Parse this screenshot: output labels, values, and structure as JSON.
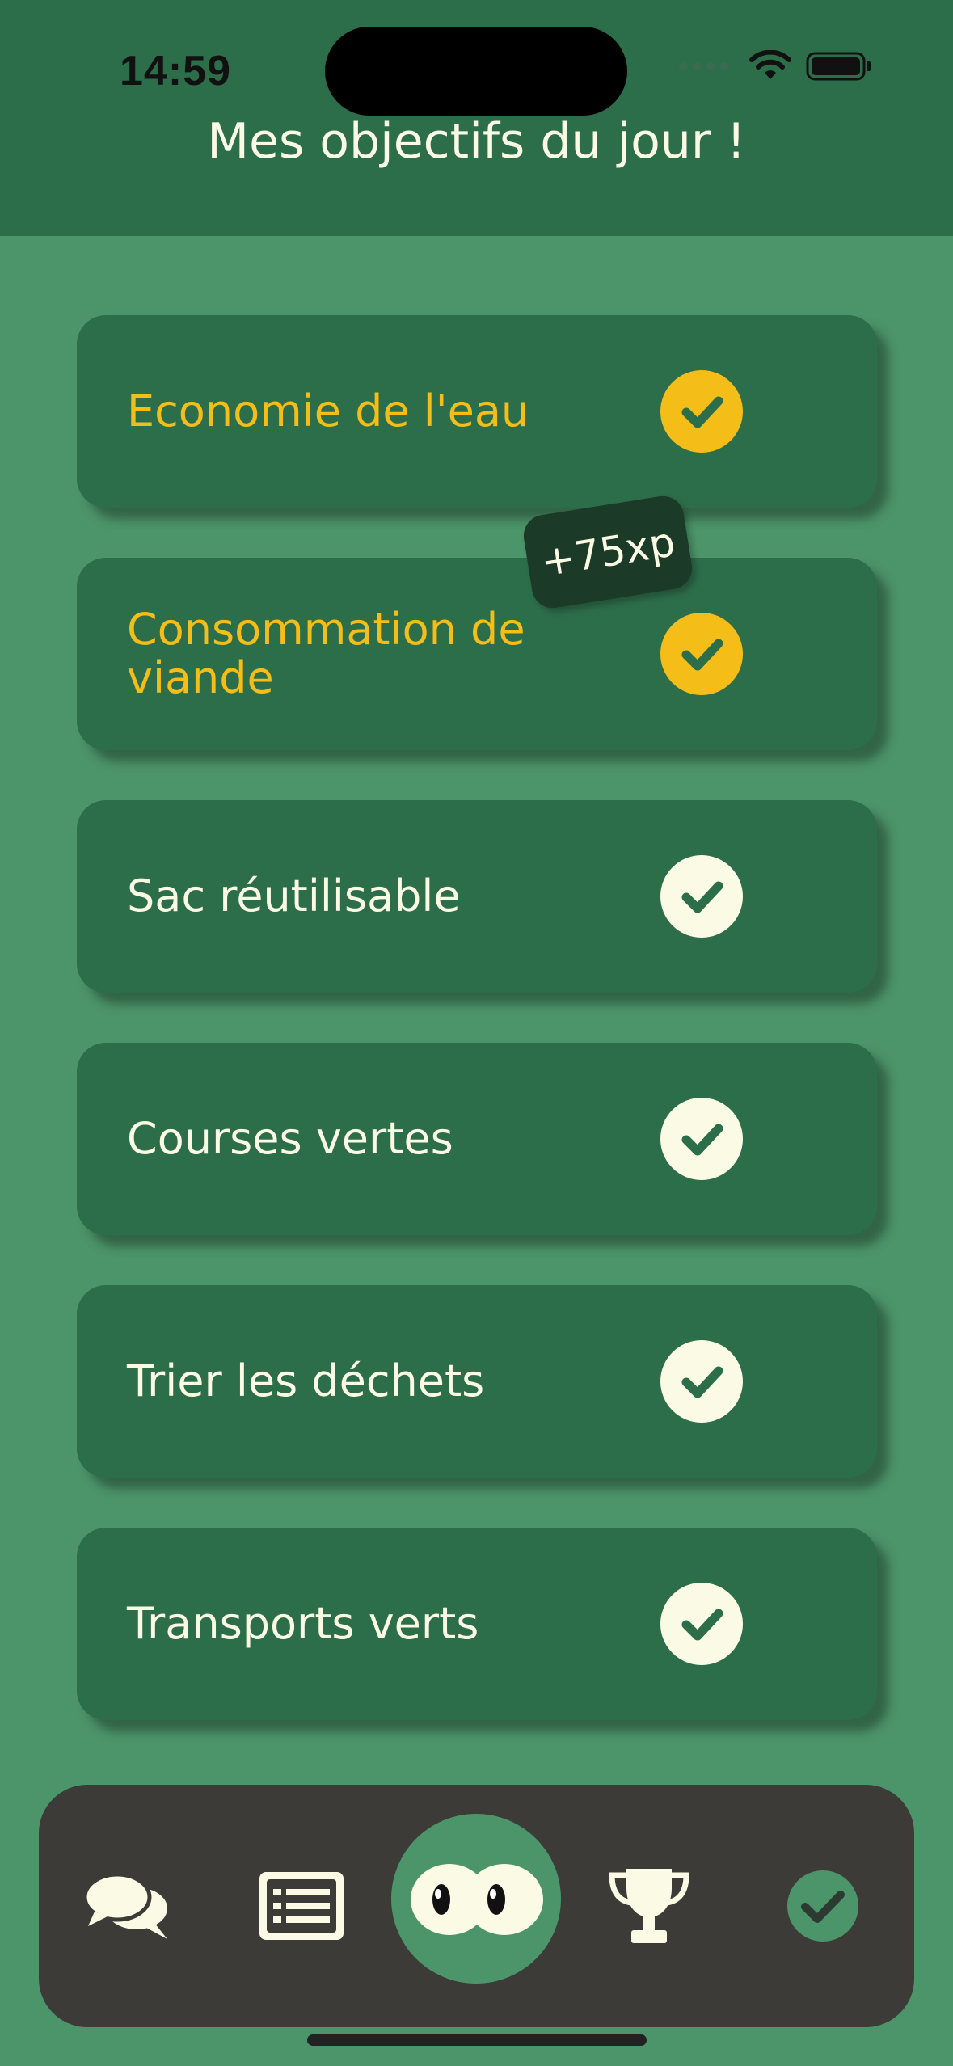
{
  "status_bar": {
    "time": "14:59"
  },
  "header": {
    "title": "Mes objectifs du jour !"
  },
  "goals": [
    {
      "label": "Economie de l'eau",
      "completed": true
    },
    {
      "label": "Consommation de viande",
      "completed": true
    },
    {
      "label": "Sac réutilisable",
      "completed": false
    },
    {
      "label": "Courses vertes",
      "completed": false
    },
    {
      "label": "Trier les déchets",
      "completed": false
    },
    {
      "label": "Transports verts",
      "completed": false
    }
  ],
  "xp_badge": {
    "text": "+75xp"
  },
  "tab_bar": {
    "items": [
      {
        "icon": "chat-bubbles-icon"
      },
      {
        "icon": "list-icon"
      },
      {
        "icon": "eyes-mascot-icon"
      },
      {
        "icon": "trophy-icon"
      },
      {
        "icon": "check-circle-icon",
        "active": true
      }
    ]
  },
  "colors": {
    "background": "#4c946a",
    "header": "#2d6e4a",
    "card": "#2d6e4a",
    "completed_accent": "#f5bd18",
    "text_light": "#fbfae5",
    "tab_bar": "#3c3b37",
    "badge": "#1c3a28"
  }
}
